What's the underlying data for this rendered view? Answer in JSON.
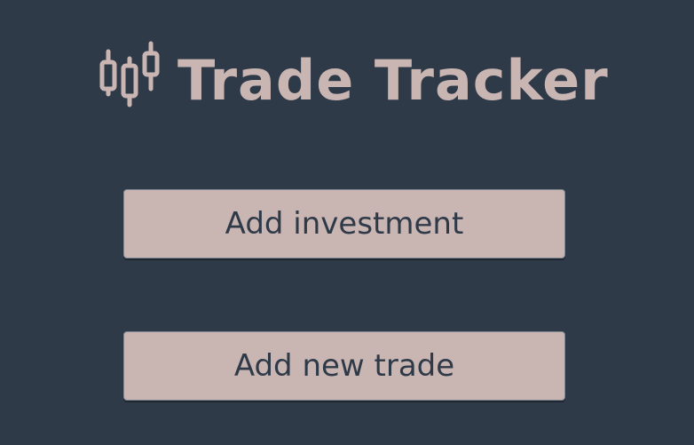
{
  "app": {
    "title": "Trade Tracker",
    "logo_icon": "candlestick-chart-icon",
    "colors": {
      "background": "#2f3a49",
      "accent": "#c9b6b3",
      "button_text": "#2f3a49"
    }
  },
  "actions": {
    "add_investment_label": "Add investment",
    "add_trade_label": "Add new trade"
  }
}
